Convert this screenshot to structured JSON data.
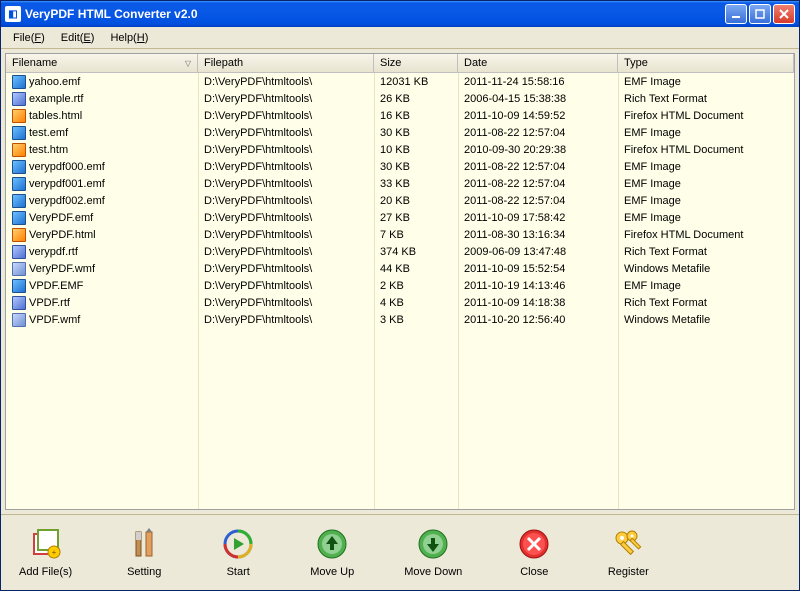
{
  "window": {
    "title": "VeryPDF HTML Converter v2.0"
  },
  "menu": {
    "file": "File(F)",
    "edit": "Edit(E)",
    "help": "Help(H)"
  },
  "columns": {
    "filename": "Filename",
    "filepath": "Filepath",
    "size": "Size",
    "date": "Date",
    "type": "Type"
  },
  "files": [
    {
      "icon": "emf",
      "name": "yahoo.emf",
      "path": "D:\\VeryPDF\\htmltools\\",
      "size": "12031 KB",
      "date": "2011-11-24 15:58:16",
      "type": "EMF Image"
    },
    {
      "icon": "rtf",
      "name": "example.rtf",
      "path": "D:\\VeryPDF\\htmltools\\",
      "size": "26 KB",
      "date": "2006-04-15 15:38:38",
      "type": "Rich Text Format"
    },
    {
      "icon": "html",
      "name": "tables.html",
      "path": "D:\\VeryPDF\\htmltools\\",
      "size": "16 KB",
      "date": "2011-10-09 14:59:52",
      "type": "Firefox HTML Document"
    },
    {
      "icon": "emf",
      "name": "test.emf",
      "path": "D:\\VeryPDF\\htmltools\\",
      "size": "30 KB",
      "date": "2011-08-22 12:57:04",
      "type": "EMF Image"
    },
    {
      "icon": "htm",
      "name": "test.htm",
      "path": "D:\\VeryPDF\\htmltools\\",
      "size": "10 KB",
      "date": "2010-09-30 20:29:38",
      "type": "Firefox HTML Document"
    },
    {
      "icon": "emf",
      "name": "verypdf000.emf",
      "path": "D:\\VeryPDF\\htmltools\\",
      "size": "30 KB",
      "date": "2011-08-22 12:57:04",
      "type": "EMF Image"
    },
    {
      "icon": "emf",
      "name": "verypdf001.emf",
      "path": "D:\\VeryPDF\\htmltools\\",
      "size": "33 KB",
      "date": "2011-08-22 12:57:04",
      "type": "EMF Image"
    },
    {
      "icon": "emf",
      "name": "verypdf002.emf",
      "path": "D:\\VeryPDF\\htmltools\\",
      "size": "20 KB",
      "date": "2011-08-22 12:57:04",
      "type": "EMF Image"
    },
    {
      "icon": "emf",
      "name": "VeryPDF.emf",
      "path": "D:\\VeryPDF\\htmltools\\",
      "size": "27 KB",
      "date": "2011-10-09 17:58:42",
      "type": "EMF Image"
    },
    {
      "icon": "html",
      "name": "VeryPDF.html",
      "path": "D:\\VeryPDF\\htmltools\\",
      "size": "7 KB",
      "date": "2011-08-30 13:16:34",
      "type": "Firefox HTML Document"
    },
    {
      "icon": "rtf",
      "name": "verypdf.rtf",
      "path": "D:\\VeryPDF\\htmltools\\",
      "size": "374 KB",
      "date": "2009-06-09 13:47:48",
      "type": "Rich Text Format"
    },
    {
      "icon": "wmf",
      "name": "VeryPDF.wmf",
      "path": "D:\\VeryPDF\\htmltools\\",
      "size": "44 KB",
      "date": "2011-10-09 15:52:54",
      "type": "Windows Metafile"
    },
    {
      "icon": "emf",
      "name": "VPDF.EMF",
      "path": "D:\\VeryPDF\\htmltools\\",
      "size": "2 KB",
      "date": "2011-10-19 14:13:46",
      "type": "EMF Image"
    },
    {
      "icon": "rtf",
      "name": "VPDF.rtf",
      "path": "D:\\VeryPDF\\htmltools\\",
      "size": "4 KB",
      "date": "2011-10-09 14:18:38",
      "type": "Rich Text Format"
    },
    {
      "icon": "wmf",
      "name": "VPDF.wmf",
      "path": "D:\\VeryPDF\\htmltools\\",
      "size": "3 KB",
      "date": "2011-10-20 12:56:40",
      "type": "Windows Metafile"
    }
  ],
  "toolbar": {
    "add": "Add File(s)",
    "setting": "Setting",
    "start": "Start",
    "moveup": "Move Up",
    "movedown": "Move Down",
    "close": "Close",
    "register": "Register"
  }
}
